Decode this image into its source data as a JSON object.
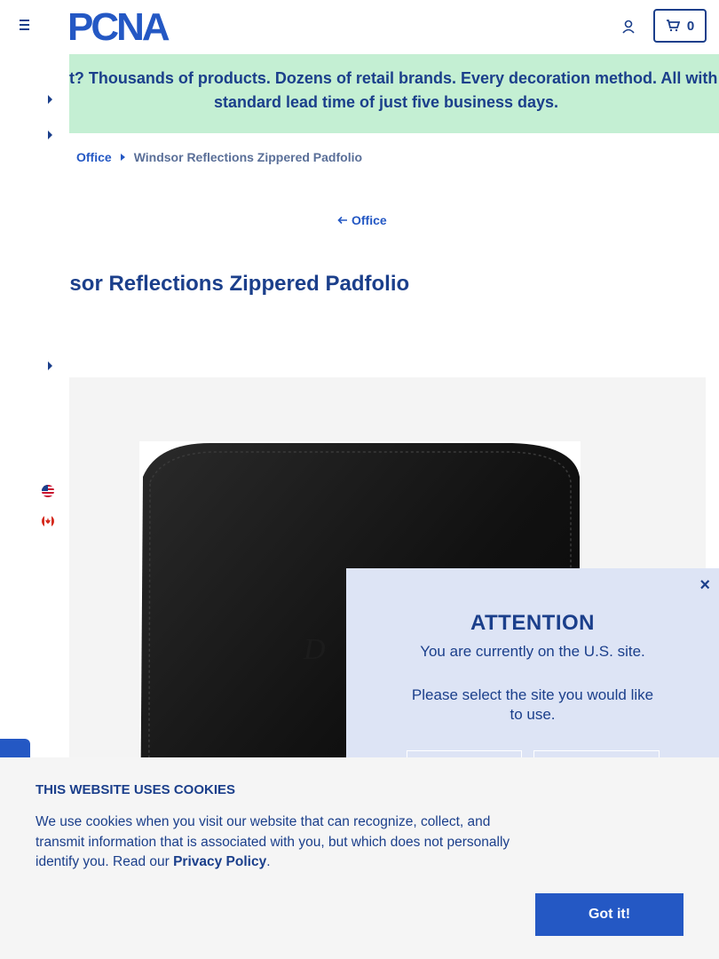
{
  "header": {
    "logo_text": "PCNA",
    "cart_count": "0"
  },
  "banner": {
    "text": "Wait? Thousands of products. Dozens of retail brands. Every decoration method. All with a standard lead time of just five business days."
  },
  "breadcrumb": {
    "parent": "Office",
    "current": "Windsor Reflections Zippered Padfolio"
  },
  "back_link": {
    "label": "Office"
  },
  "product": {
    "title": "Windsor Reflections Zippered Padfolio"
  },
  "attention_modal": {
    "heading": "ATTENTION",
    "current_site": "You are currently on the U.S. site.",
    "prompt": "Please select the site you would like to use.",
    "close": "×"
  },
  "cookie_banner": {
    "heading": "THIS WEBSITE USES COOKIES",
    "body": "We use cookies when you visit our website that can recognize, collect, and transmit information that is associated with you, but which does not personally identify you. Read our ",
    "privacy_link": "Privacy Policy",
    "period": ".",
    "accept_button": "Got it!"
  },
  "colors": {
    "brand_blue": "#1b3f8b",
    "link_blue": "#2458c4",
    "banner_green": "#c4efd3",
    "modal_bg": "#dde4f5"
  },
  "icons": [
    "hamburger-icon",
    "account-icon",
    "cart-icon",
    "caret-icon",
    "us-flag-icon",
    "canada-flag-icon",
    "back-arrow-icon",
    "close-icon"
  ]
}
